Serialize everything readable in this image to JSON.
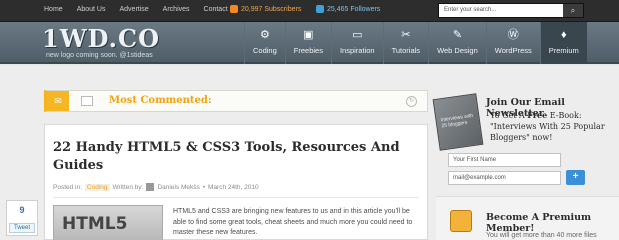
{
  "topbar": {
    "nav": [
      "Home",
      "About Us",
      "Advertise",
      "Archives",
      "Contact"
    ],
    "subscribers": "20,997 Subscribers",
    "followers": "25,465 Followers",
    "search_placeholder": "Enter your search..."
  },
  "header": {
    "logo": "1WD.CO",
    "tagline": "new logo coming soon. @1stideas",
    "nav": [
      {
        "label": "Coding",
        "icon": "gear-icon",
        "glyph": "⚙"
      },
      {
        "label": "Freebies",
        "icon": "freebies-icon",
        "glyph": "▣"
      },
      {
        "label": "Inspiration",
        "icon": "monitor-icon",
        "glyph": "▭"
      },
      {
        "label": "Tutorials",
        "icon": "scissors-icon",
        "glyph": "✂"
      },
      {
        "label": "Web Design",
        "icon": "pen-icon",
        "glyph": "✎"
      },
      {
        "label": "WordPress",
        "icon": "wordpress-icon",
        "glyph": "Ⓦ"
      },
      {
        "label": "Premium",
        "icon": "bag-icon",
        "glyph": "♦"
      }
    ]
  },
  "most_commented": {
    "label": "Most Commented:"
  },
  "article": {
    "title": "22 Handy HTML5 & CSS3 Tools, Resources And Guides",
    "meta_posted": "Posted in:",
    "meta_category": "Coding",
    "meta_written": "Written by:",
    "meta_author": "Daniels Mekšs",
    "meta_date": "March 24th, 2010",
    "thumb_text": "HTML5",
    "excerpt": "HTML5 and CSS3 are bringing new features to us and in this article you'll be able to find some great tools, cheat sheets and much more you could need to master these new features."
  },
  "share": {
    "count": "9",
    "tweet": "Tweet"
  },
  "sidebar": {
    "newsletter_title": "Join Our Email Newsletter",
    "newsletter_prefix": "To Get A",
    "newsletter_free": "Free",
    "newsletter_ebook": "E-Book:",
    "newsletter_line2": "\"Interviews With 25 Popular",
    "newsletter_line3": "Bloggers\" now!",
    "name_placeholder": "Your First Name",
    "email_placeholder": "mail@example.com",
    "submit_glyph": "+",
    "book_text": "Interviews with 25 bloggers",
    "premium_title": "Become A Premium Member!",
    "premium_more": "You will get more than 40 more files"
  }
}
